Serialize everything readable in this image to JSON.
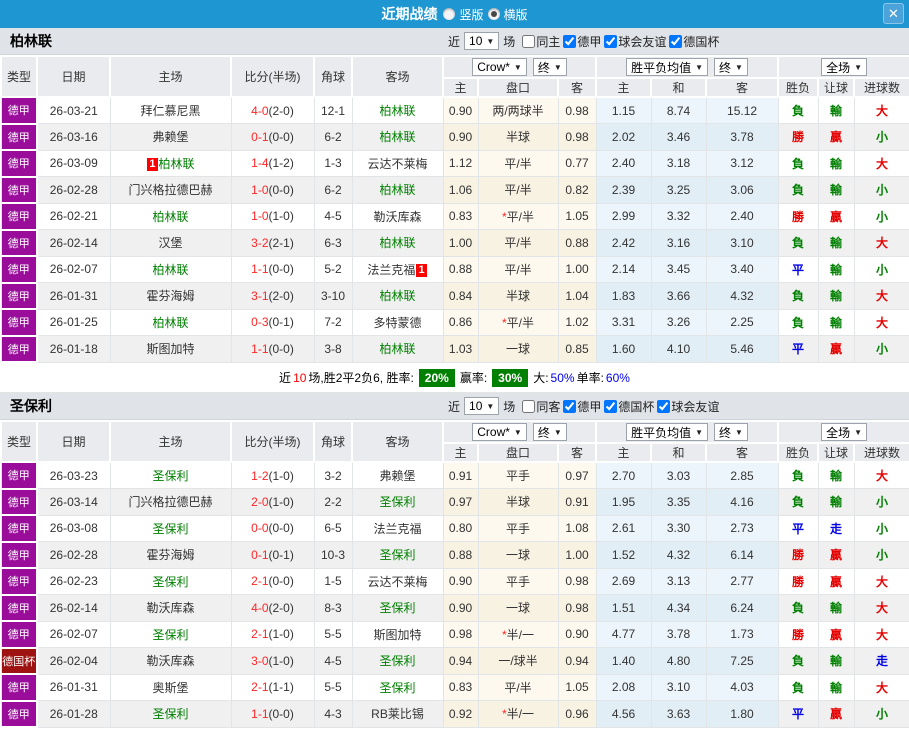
{
  "titlebar": {
    "title": "近期战绩",
    "radio_vertical": "竖版",
    "radio_horizontal": "横版",
    "selected": "横版",
    "close": "✕"
  },
  "colors": {
    "topbar": "#1e96d2",
    "league": {
      "德甲": "#9a0d9b",
      "德国杯": "#9e1212"
    },
    "focus_team": "#008000",
    "score_red": "#ff2626",
    "status": {
      "勝": "#e60000",
      "贏": "#e60000",
      "大": "#e60000",
      "負": "#008000",
      "輸": "#008000",
      "小": "#008000",
      "平": "#0000e6",
      "走": "#0000e6"
    },
    "summary_badge": "#008000"
  },
  "table_headers": {
    "main": [
      "类型",
      "日期",
      "主场",
      "比分(半场)",
      "角球",
      "客场"
    ],
    "sub": [
      "主",
      "盘口",
      "客",
      "主",
      "和",
      "客",
      "胜负",
      "让球",
      "进球数"
    ],
    "group_selects": [
      [
        "Crow*",
        "终"
      ],
      [
        "胜平负均值",
        "终"
      ],
      [
        "全场"
      ]
    ]
  },
  "sections": [
    {
      "team": "柏林联",
      "filter": {
        "jin": "近",
        "count": "10",
        "chang": "场",
        "checks": [
          {
            "label": "同主",
            "checked": false
          },
          {
            "label": "德甲",
            "checked": true
          },
          {
            "label": "球会友谊",
            "checked": true
          },
          {
            "label": "德国杯",
            "checked": true
          }
        ]
      },
      "rows": [
        {
          "type": "德甲",
          "date": "26-03-21",
          "home": {
            "name": "拜仁慕尼黑"
          },
          "score": "4-0",
          "half": "(2-0)",
          "corner": "12-1",
          "away": {
            "name": "柏林联",
            "focus": true
          },
          "asia": [
            "0.90",
            "两/两球半",
            "0.98"
          ],
          "europe": [
            "1.15",
            "8.74",
            "15.12"
          ],
          "result": "負",
          "handicap": "輸",
          "goals": "大"
        },
        {
          "type": "德甲",
          "date": "26-03-16",
          "home": {
            "name": "弗赖堡"
          },
          "score": "0-1",
          "half": "(0-0)",
          "corner": "6-2",
          "away": {
            "name": "柏林联",
            "focus": true
          },
          "asia": [
            "0.90",
            "半球",
            "0.98"
          ],
          "europe": [
            "2.02",
            "3.46",
            "3.78"
          ],
          "result": "勝",
          "handicap": "贏",
          "goals": "小"
        },
        {
          "type": "德甲",
          "date": "26-03-09",
          "home": {
            "name": "柏林联",
            "focus": true,
            "badge": "1",
            "badge_pos": "left"
          },
          "score": "1-4",
          "half": "(1-2)",
          "corner": "1-3",
          "away": {
            "name": "云达不莱梅"
          },
          "asia": [
            "1.12",
            "平/半",
            "0.77"
          ],
          "europe": [
            "2.40",
            "3.18",
            "3.12"
          ],
          "result": "負",
          "handicap": "輸",
          "goals": "大"
        },
        {
          "type": "德甲",
          "date": "26-02-28",
          "home": {
            "name": "门兴格拉德巴赫"
          },
          "score": "1-0",
          "half": "(0-0)",
          "corner": "6-2",
          "away": {
            "name": "柏林联",
            "focus": true
          },
          "asia": [
            "1.06",
            "平/半",
            "0.82"
          ],
          "europe": [
            "2.39",
            "3.25",
            "3.06"
          ],
          "result": "負",
          "handicap": "輸",
          "goals": "小"
        },
        {
          "type": "德甲",
          "date": "26-02-21",
          "home": {
            "name": "柏林联",
            "focus": true
          },
          "score": "1-0",
          "half": "(1-0)",
          "corner": "4-5",
          "away": {
            "name": "勒沃库森"
          },
          "asia": [
            "0.83",
            "*平/半",
            "1.05"
          ],
          "europe": [
            "2.99",
            "3.32",
            "2.40"
          ],
          "result": "勝",
          "handicap": "贏",
          "goals": "小"
        },
        {
          "type": "德甲",
          "date": "26-02-14",
          "home": {
            "name": "汉堡"
          },
          "score": "3-2",
          "half": "(2-1)",
          "corner": "6-3",
          "away": {
            "name": "柏林联",
            "focus": true
          },
          "asia": [
            "1.00",
            "平/半",
            "0.88"
          ],
          "europe": [
            "2.42",
            "3.16",
            "3.10"
          ],
          "result": "負",
          "handicap": "輸",
          "goals": "大"
        },
        {
          "type": "德甲",
          "date": "26-02-07",
          "home": {
            "name": "柏林联",
            "focus": true
          },
          "score": "1-1",
          "half": "(0-0)",
          "corner": "5-2",
          "away": {
            "name": "法兰克福",
            "badge": "1",
            "badge_pos": "right"
          },
          "asia": [
            "0.88",
            "平/半",
            "1.00"
          ],
          "europe": [
            "2.14",
            "3.45",
            "3.40"
          ],
          "result": "平",
          "handicap": "輸",
          "goals": "小"
        },
        {
          "type": "德甲",
          "date": "26-01-31",
          "home": {
            "name": "霍芬海姆"
          },
          "score": "3-1",
          "half": "(2-0)",
          "corner": "3-10",
          "away": {
            "name": "柏林联",
            "focus": true
          },
          "asia": [
            "0.84",
            "半球",
            "1.04"
          ],
          "europe": [
            "1.83",
            "3.66",
            "4.32"
          ],
          "result": "負",
          "handicap": "輸",
          "goals": "大"
        },
        {
          "type": "德甲",
          "date": "26-01-25",
          "home": {
            "name": "柏林联",
            "focus": true
          },
          "score": "0-3",
          "half": "(0-1)",
          "corner": "7-2",
          "away": {
            "name": "多特蒙德"
          },
          "asia": [
            "0.86",
            "*平/半",
            "1.02"
          ],
          "europe": [
            "3.31",
            "3.26",
            "2.25"
          ],
          "result": "負",
          "handicap": "輸",
          "goals": "大"
        },
        {
          "type": "德甲",
          "date": "26-01-18",
          "home": {
            "name": "斯图加特"
          },
          "score": "1-1",
          "half": "(0-0)",
          "corner": "3-8",
          "away": {
            "name": "柏林联",
            "focus": true
          },
          "asia": [
            "1.03",
            "一球",
            "0.85"
          ],
          "europe": [
            "1.60",
            "4.10",
            "5.46"
          ],
          "result": "平",
          "handicap": "贏",
          "goals": "小"
        }
      ],
      "summary": {
        "t1": "近",
        "num": "10",
        "t2": "场,胜2平2负6, 胜率:",
        "rate1": "20%",
        "t3": "赢率:",
        "rate2": "30%",
        "t4": "大:",
        "v3": "50%",
        "t5": "单率:",
        "v4": "60%"
      }
    },
    {
      "team": "圣保利",
      "filter": {
        "jin": "近",
        "count": "10",
        "chang": "场",
        "checks": [
          {
            "label": "同客",
            "checked": false
          },
          {
            "label": "德甲",
            "checked": true
          },
          {
            "label": "德国杯",
            "checked": true
          },
          {
            "label": "球会友谊",
            "checked": true
          }
        ]
      },
      "rows": [
        {
          "type": "德甲",
          "date": "26-03-23",
          "home": {
            "name": "圣保利",
            "focus": true
          },
          "score": "1-2",
          "half": "(1-0)",
          "corner": "3-2",
          "away": {
            "name": "弗赖堡"
          },
          "asia": [
            "0.91",
            "平手",
            "0.97"
          ],
          "europe": [
            "2.70",
            "3.03",
            "2.85"
          ],
          "result": "負",
          "handicap": "輸",
          "goals": "大"
        },
        {
          "type": "德甲",
          "date": "26-03-14",
          "home": {
            "name": "门兴格拉德巴赫"
          },
          "score": "2-0",
          "half": "(1-0)",
          "corner": "2-2",
          "away": {
            "name": "圣保利",
            "focus": true
          },
          "asia": [
            "0.97",
            "半球",
            "0.91"
          ],
          "europe": [
            "1.95",
            "3.35",
            "4.16"
          ],
          "result": "負",
          "handicap": "輸",
          "goals": "小"
        },
        {
          "type": "德甲",
          "date": "26-03-08",
          "home": {
            "name": "圣保利",
            "focus": true
          },
          "score": "0-0",
          "half": "(0-0)",
          "corner": "6-5",
          "away": {
            "name": "法兰克福"
          },
          "asia": [
            "0.80",
            "平手",
            "1.08"
          ],
          "europe": [
            "2.61",
            "3.30",
            "2.73"
          ],
          "result": "平",
          "handicap": "走",
          "goals": "小"
        },
        {
          "type": "德甲",
          "date": "26-02-28",
          "home": {
            "name": "霍芬海姆"
          },
          "score": "0-1",
          "half": "(0-1)",
          "corner": "10-3",
          "away": {
            "name": "圣保利",
            "focus": true
          },
          "asia": [
            "0.88",
            "一球",
            "1.00"
          ],
          "europe": [
            "1.52",
            "4.32",
            "6.14"
          ],
          "result": "勝",
          "handicap": "贏",
          "goals": "小"
        },
        {
          "type": "德甲",
          "date": "26-02-23",
          "home": {
            "name": "圣保利",
            "focus": true
          },
          "score": "2-1",
          "half": "(0-0)",
          "corner": "1-5",
          "away": {
            "name": "云达不莱梅"
          },
          "asia": [
            "0.90",
            "平手",
            "0.98"
          ],
          "europe": [
            "2.69",
            "3.13",
            "2.77"
          ],
          "result": "勝",
          "handicap": "贏",
          "goals": "大"
        },
        {
          "type": "德甲",
          "date": "26-02-14",
          "home": {
            "name": "勒沃库森"
          },
          "score": "4-0",
          "half": "(2-0)",
          "corner": "8-3",
          "away": {
            "name": "圣保利",
            "focus": true
          },
          "asia": [
            "0.90",
            "一球",
            "0.98"
          ],
          "europe": [
            "1.51",
            "4.34",
            "6.24"
          ],
          "result": "負",
          "handicap": "輸",
          "goals": "大"
        },
        {
          "type": "德甲",
          "date": "26-02-07",
          "home": {
            "name": "圣保利",
            "focus": true
          },
          "score": "2-1",
          "half": "(1-0)",
          "corner": "5-5",
          "away": {
            "name": "斯图加特"
          },
          "asia": [
            "0.98",
            "*半/一",
            "0.90"
          ],
          "europe": [
            "4.77",
            "3.78",
            "1.73"
          ],
          "result": "勝",
          "handicap": "贏",
          "goals": "大"
        },
        {
          "type": "德国杯",
          "date": "26-02-04",
          "home": {
            "name": "勒沃库森"
          },
          "score": "3-0",
          "half": "(1-0)",
          "corner": "4-5",
          "away": {
            "name": "圣保利",
            "focus": true
          },
          "asia": [
            "0.94",
            "一/球半",
            "0.94"
          ],
          "europe": [
            "1.40",
            "4.80",
            "7.25"
          ],
          "result": "負",
          "handicap": "輸",
          "goals": "走"
        },
        {
          "type": "德甲",
          "date": "26-01-31",
          "home": {
            "name": "奥斯堡"
          },
          "score": "2-1",
          "half": "(1-1)",
          "corner": "5-5",
          "away": {
            "name": "圣保利",
            "focus": true
          },
          "asia": [
            "0.83",
            "平/半",
            "1.05"
          ],
          "europe": [
            "2.08",
            "3.10",
            "4.03"
          ],
          "result": "負",
          "handicap": "輸",
          "goals": "大"
        },
        {
          "type": "德甲",
          "date": "26-01-28",
          "home": {
            "name": "圣保利",
            "focus": true
          },
          "score": "1-1",
          "half": "(0-0)",
          "corner": "4-3",
          "away": {
            "name": "RB莱比锡"
          },
          "asia": [
            "0.92",
            "*半/一",
            "0.96"
          ],
          "europe": [
            "4.56",
            "3.63",
            "1.80"
          ],
          "result": "平",
          "handicap": "贏",
          "goals": "小"
        }
      ]
    }
  ]
}
